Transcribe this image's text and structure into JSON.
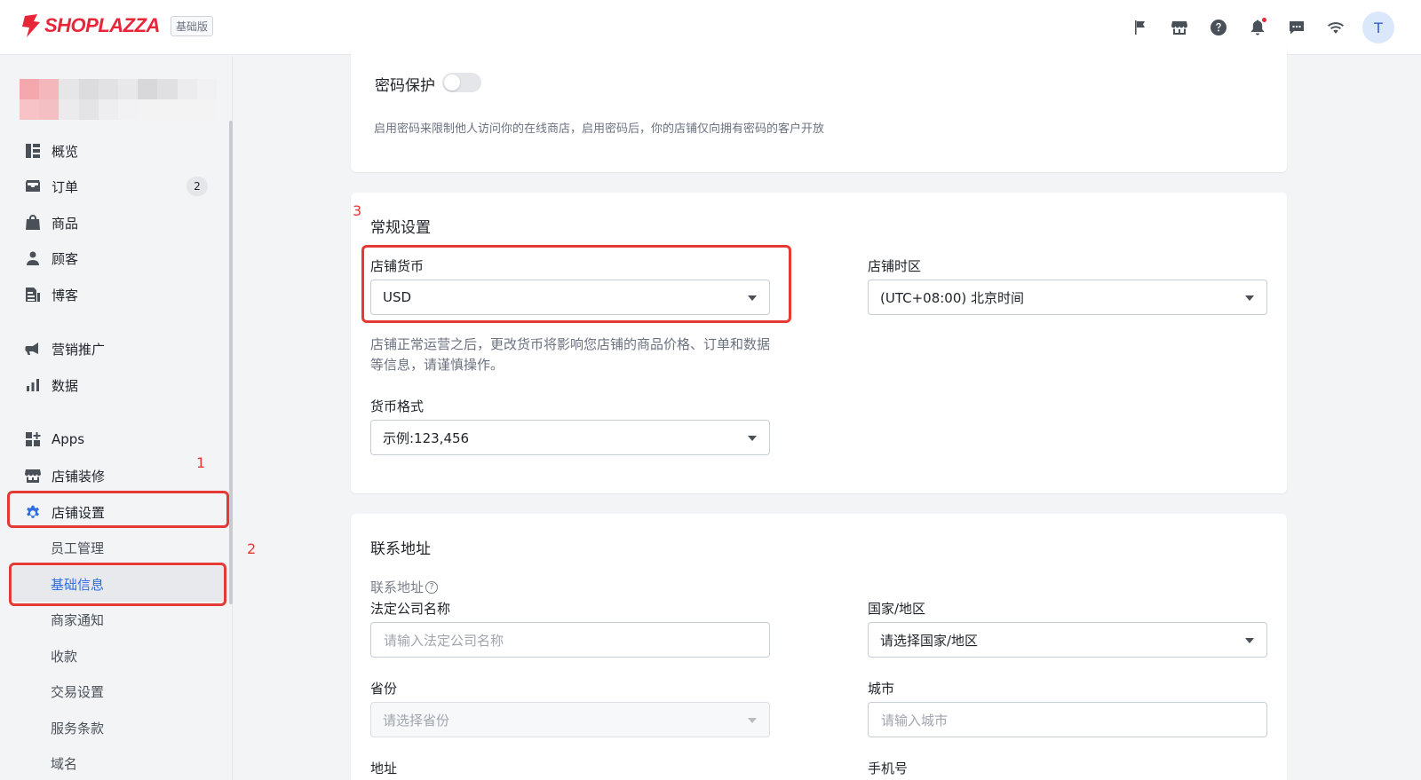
{
  "brand": {
    "name": "SHOPLAZZA",
    "plan": "基础版",
    "accent": "#e8263a"
  },
  "header": {
    "icons": [
      "flag-icon",
      "store-icon",
      "help-icon",
      "bell-icon",
      "chat-icon",
      "wifi-icon"
    ],
    "avatar_initial": "T"
  },
  "sidebar": {
    "items": [
      {
        "label": "概览",
        "icon": "dashboard-icon"
      },
      {
        "label": "订单",
        "icon": "inbox-icon",
        "count": "2"
      },
      {
        "label": "商品",
        "icon": "bag-icon"
      },
      {
        "label": "顾客",
        "icon": "person-icon"
      },
      {
        "label": "博客",
        "icon": "blog-icon"
      },
      {
        "label": "营销推广",
        "icon": "megaphone-icon"
      },
      {
        "label": "数据",
        "icon": "bar-chart-icon"
      },
      {
        "label": "Apps",
        "icon": "apps-icon"
      },
      {
        "label": "店铺装修",
        "icon": "storefront-icon"
      },
      {
        "label": "店铺设置",
        "icon": "gear-icon"
      }
    ],
    "subitems": [
      "员工管理",
      "基础信息",
      "商家通知",
      "收款",
      "交易设置",
      "服务条款",
      "域名"
    ],
    "annotations": [
      "1",
      "2"
    ]
  },
  "password_card": {
    "title": "密码保护",
    "description": "启用密码来限制他人访问你的在线商店，启用密码后，你的店铺仅向拥有密码的客户开放",
    "enabled": false
  },
  "general_card": {
    "annotation": "3",
    "title": "常规设置",
    "currency_label": "店铺货币",
    "currency_value": "USD",
    "currency_help": "店铺正常运营之后，更改货币将影响您店铺的商品价格、订单和数据等信息，请谨慎操作。",
    "format_label": "货币格式",
    "format_value": "示例:123,456",
    "timezone_label": "店铺时区",
    "timezone_value": "(UTC+08:00) 北京时间"
  },
  "address_card": {
    "title": "联系地址",
    "sub_link": "联系地址",
    "company_label": "法定公司名称",
    "company_placeholder": "请输入法定公司名称",
    "country_label": "国家/地区",
    "country_value": "请选择国家/地区",
    "province_label": "省份",
    "province_value": "请选择省份",
    "city_label": "城市",
    "city_placeholder": "请输入城市",
    "address_label": "地址",
    "phone_label": "手机号"
  }
}
